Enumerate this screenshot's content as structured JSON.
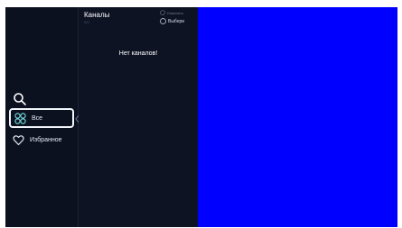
{
  "sidebar": {
    "items": [
      {
        "icon": "grid-icon",
        "label": "Все",
        "active": true
      },
      {
        "icon": "heart-icon",
        "label": "Избранное",
        "active": false
      }
    ]
  },
  "channels": {
    "title": "Каналы",
    "count": "0/0",
    "edit_label": "Изменить",
    "select_label": "Выбери",
    "empty_message": "Нет каналов!"
  },
  "colors": {
    "background": "#0e1324",
    "sidebar_bg": "#0c1120",
    "preview": "#0000fe",
    "text": "#ffffff",
    "muted": "#6f7a93"
  }
}
